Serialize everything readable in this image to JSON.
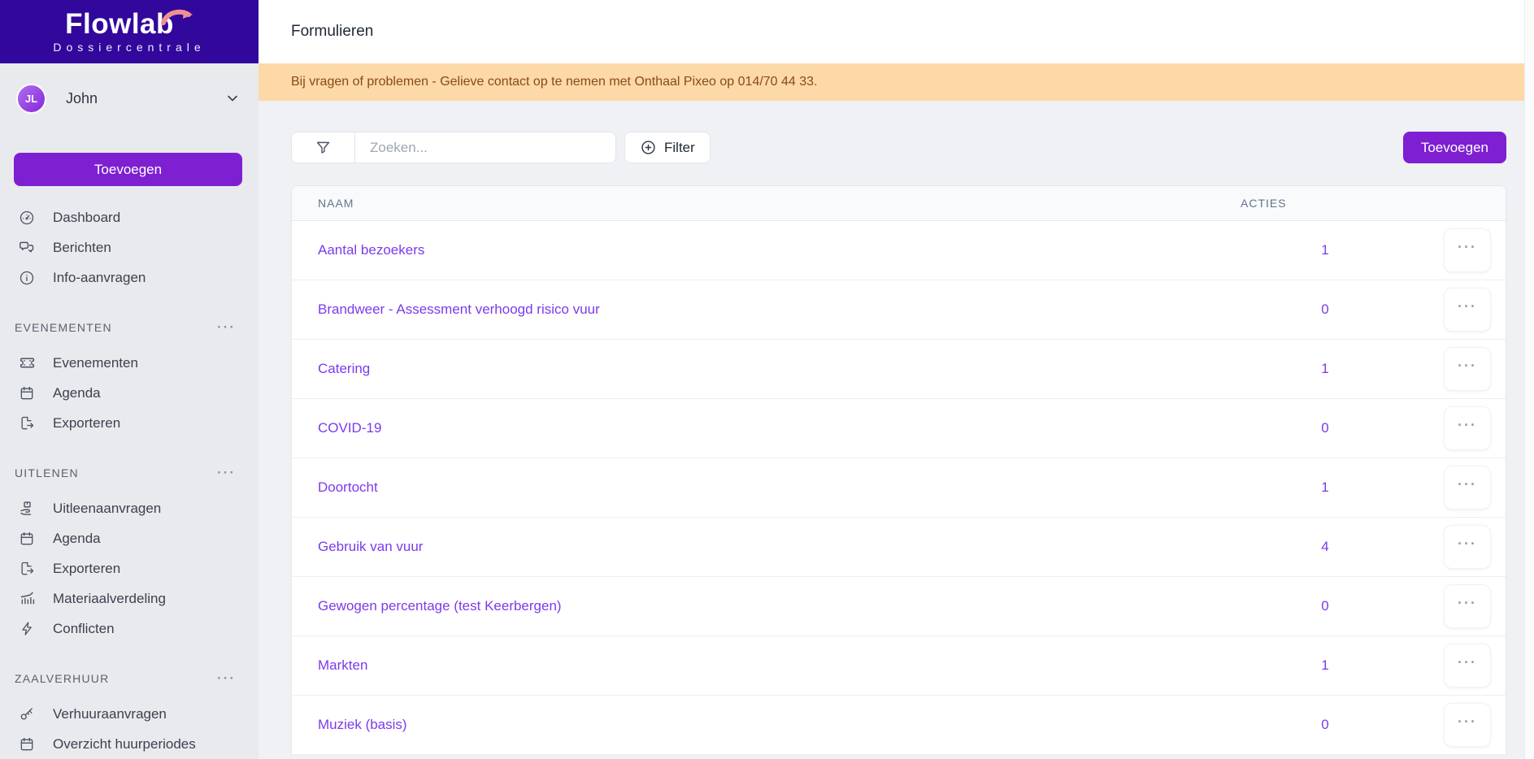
{
  "logo": {
    "title": "Flowlab",
    "subtitle": "Dossiercentrale"
  },
  "user": {
    "initials": "JL",
    "name": "John"
  },
  "sidebar": {
    "cta_label": "Toevoegen",
    "items": [
      {
        "label": "Dashboard",
        "icon": "gauge-icon"
      },
      {
        "label": "Berichten",
        "icon": "chat-icon"
      },
      {
        "label": "Info-aanvragen",
        "icon": "info-icon"
      }
    ],
    "sections": [
      {
        "title": "EVENEMENTEN",
        "menu": "···",
        "items": [
          {
            "label": "Evenementen",
            "icon": "ticket-icon"
          },
          {
            "label": "Agenda",
            "icon": "calendar-icon"
          },
          {
            "label": "Exporteren",
            "icon": "export-icon"
          }
        ]
      },
      {
        "title": "UITLENEN",
        "menu": "···",
        "items": [
          {
            "label": "Uitleenaanvragen",
            "icon": "hand-box-icon"
          },
          {
            "label": "Agenda",
            "icon": "calendar-icon"
          },
          {
            "label": "Exporteren",
            "icon": "export-icon"
          },
          {
            "label": "Materiaalverdeling",
            "icon": "chart-icon"
          },
          {
            "label": "Conflicten",
            "icon": "lightning-icon"
          }
        ]
      },
      {
        "title": "ZAALVERHUUR",
        "menu": "···",
        "items": [
          {
            "label": "Verhuuraanvragen",
            "icon": "key-icon"
          },
          {
            "label": "Overzicht huurperiodes",
            "icon": "calendar-icon"
          }
        ]
      }
    ]
  },
  "header": {
    "title": "Formulieren"
  },
  "banner": {
    "text": "Bij vragen of problemen - Gelieve contact op te nemen met Onthaal Pixeo op 014/70 44 33."
  },
  "toolbar": {
    "search_placeholder": "Zoeken...",
    "filter_label": "Filter",
    "add_label": "Toevoegen"
  },
  "table": {
    "columns": [
      "NAAM",
      "ACTIES"
    ],
    "row_menu_glyph": "···",
    "rows": [
      {
        "name": "Aantal bezoekers",
        "count": "1"
      },
      {
        "name": "Brandweer - Assessment verhoogd risico vuur",
        "count": "0"
      },
      {
        "name": "Catering",
        "count": "1"
      },
      {
        "name": "COVID-19",
        "count": "0"
      },
      {
        "name": "Doortocht",
        "count": "1"
      },
      {
        "name": "Gebruik van vuur",
        "count": "4"
      },
      {
        "name": "Gewogen percentage (test Keerbergen)",
        "count": "0"
      },
      {
        "name": "Markten",
        "count": "1"
      },
      {
        "name": "Muziek (basis)",
        "count": "0"
      }
    ]
  },
  "colors": {
    "brand_header": "#31079c",
    "accent_purple": "#7e1fd2",
    "link_purple": "#7c3aed",
    "banner_bg": "#fcd9a6",
    "banner_text": "#8a4a17",
    "logo_arrow": "#ef9191",
    "sidebar_bg": "#e9eaee"
  }
}
